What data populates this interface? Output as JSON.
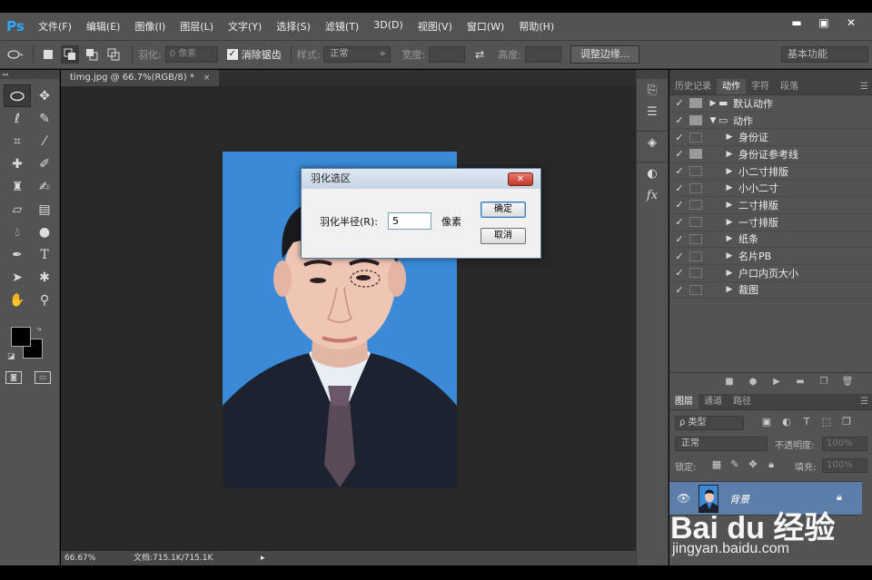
{
  "app": {
    "logo": "Ps"
  },
  "menu": [
    "文件(F)",
    "编辑(E)",
    "图像(I)",
    "图层(L)",
    "文字(Y)",
    "选择(S)",
    "滤镜(T)",
    "3D(D)",
    "视图(V)",
    "窗口(W)",
    "帮助(H)"
  ],
  "window_controls": {
    "minimize": "▬",
    "maximize": "▣",
    "close": "✕"
  },
  "options": {
    "feather_label": "羽化:",
    "feather_value": "0 像素",
    "antialias_label": "消除锯齿",
    "antialias_checked": true,
    "style_label": "样式:",
    "style_value": "正常",
    "width_label": "宽度:",
    "height_label": "高度:",
    "refine_edge": "调整边缘...",
    "workspace": "基本功能"
  },
  "document": {
    "tab_title": "timg.jpg @ 66.7%(RGB/8) *",
    "close": "×",
    "zoom": "66.67%",
    "doc_size": "文档:715.1K/715.1K"
  },
  "dialog": {
    "title": "羽化选区",
    "close": "✕",
    "radius_label": "羽化半径(R):",
    "radius_value": "5",
    "unit": "像素",
    "ok": "确定",
    "cancel": "取消"
  },
  "panel_tabs": [
    {
      "label": "历史记录",
      "active": false
    },
    {
      "label": "动作",
      "active": true
    },
    {
      "label": "字符",
      "active": false
    },
    {
      "label": "段落",
      "active": false
    }
  ],
  "actions": [
    {
      "label": "默认动作",
      "level": 0,
      "expanded": false,
      "dialog_on": true,
      "folder": true
    },
    {
      "label": "动作",
      "level": 0,
      "expanded": true,
      "dialog_on": true,
      "folder": true
    },
    {
      "label": "身份证",
      "level": 1,
      "dialog_on": false
    },
    {
      "label": "身份证参考线",
      "level": 1,
      "dialog_on": true
    },
    {
      "label": "小二寸排版",
      "level": 1,
      "dialog_on": false
    },
    {
      "label": "小小二寸",
      "level": 1,
      "dialog_on": false
    },
    {
      "label": "二寸排版",
      "level": 1,
      "dialog_on": false
    },
    {
      "label": "一寸排版",
      "level": 1,
      "dialog_on": false
    },
    {
      "label": "纸条",
      "level": 1,
      "dialog_on": false
    },
    {
      "label": "名片PB",
      "level": 1,
      "dialog_on": false
    },
    {
      "label": "户口内页大小",
      "level": 1,
      "dialog_on": false
    },
    {
      "label": "裁图",
      "level": 1,
      "dialog_on": false
    }
  ],
  "layer_tabs": [
    {
      "label": "图层",
      "active": true
    },
    {
      "label": "通道",
      "active": false
    },
    {
      "label": "路径",
      "active": false
    }
  ],
  "layers_panel": {
    "filter_label": "ρ 类型",
    "blend_mode": "正常",
    "opacity_label": "不透明度:",
    "opacity_value": "100%",
    "lock_label": "锁定:",
    "fill_label": "填充:",
    "fill_value": "100%",
    "layer_name": "背景"
  },
  "watermark": {
    "brand": "Bai du 经验",
    "url": "jingyan.baidu.com"
  },
  "colors": {
    "accent": "#31a8ff",
    "panel": "#535353",
    "canvas": "#282828",
    "photo_bg": "#3a8ad8",
    "selected_layer": "#5c7ea8"
  }
}
